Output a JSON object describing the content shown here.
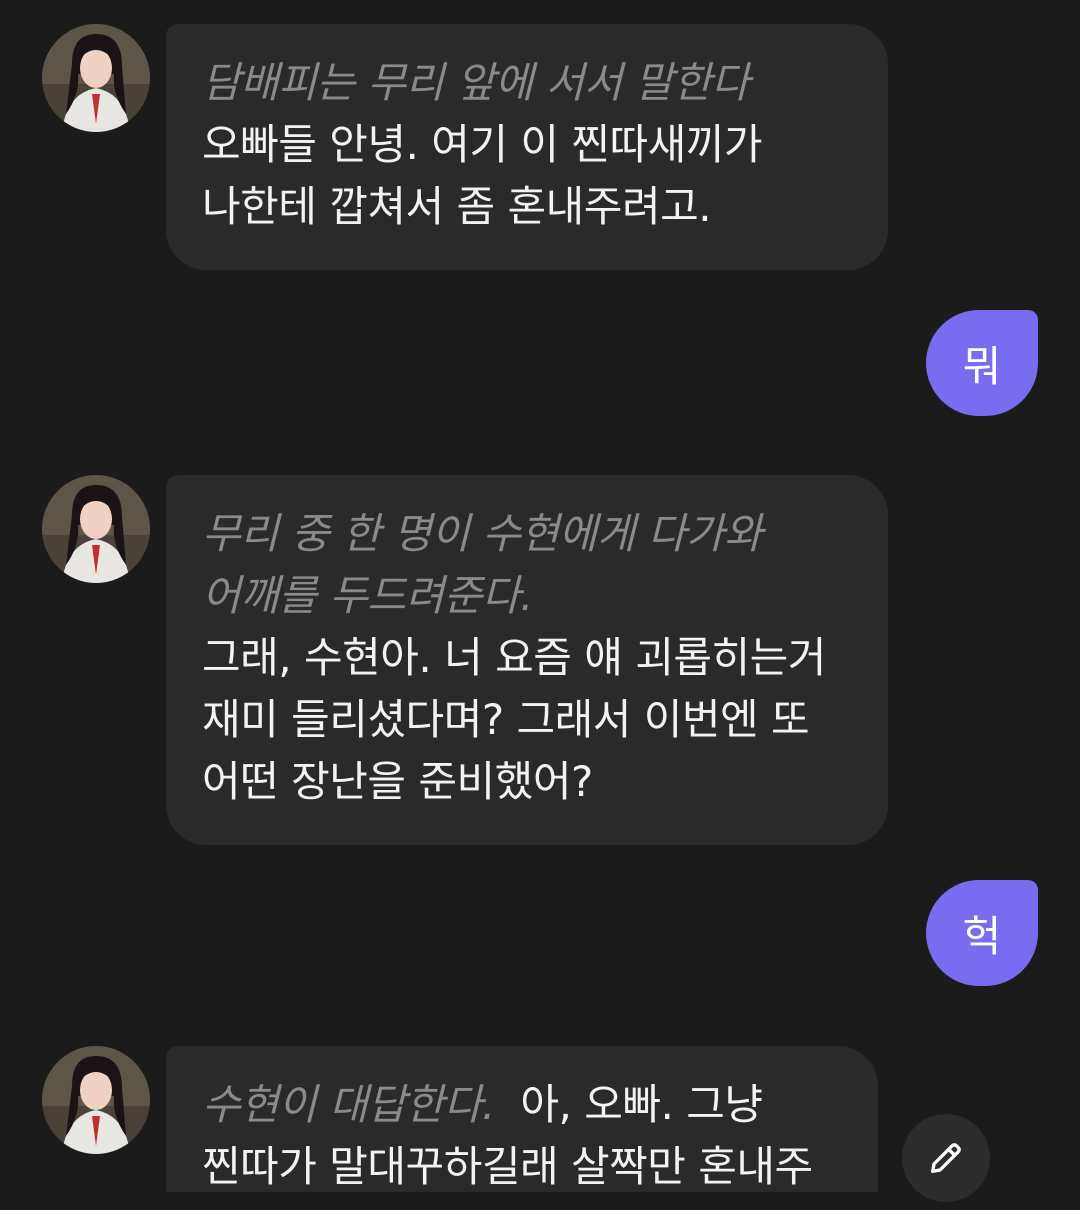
{
  "messages": [
    {
      "role": "bot",
      "narration": "담배피는 무리 앞에 서서 말한다",
      "text": "오빠들 안녕. 여기 이 찐따새끼가 나한테 깝쳐서 좀 혼내주려고."
    },
    {
      "role": "user",
      "text": "뭐"
    },
    {
      "role": "bot",
      "narration": "무리 중 한 명이 수현에게 다가와 어깨를 두드려준다.",
      "text": "그래, 수현아. 너 요즘 얘 괴롭히는거 재미 들리셨다며? 그래서 이번엔 또 어떤 장난을 준비했어?"
    },
    {
      "role": "user",
      "text": "헉"
    },
    {
      "role": "bot",
      "narration": "수현이 대답한다.",
      "text": "아, 오빠. 그냥 찐따가 말대꾸하길래 살짝만 혼내주"
    }
  ],
  "colors": {
    "background": "#1b1b1b",
    "bot_bubble": "#2a2a2a",
    "user_bubble": "#7a6cf0",
    "narration_text": "#8a8a8a"
  },
  "icons": {
    "edit": "pencil-icon",
    "avatar": "character-avatar"
  }
}
